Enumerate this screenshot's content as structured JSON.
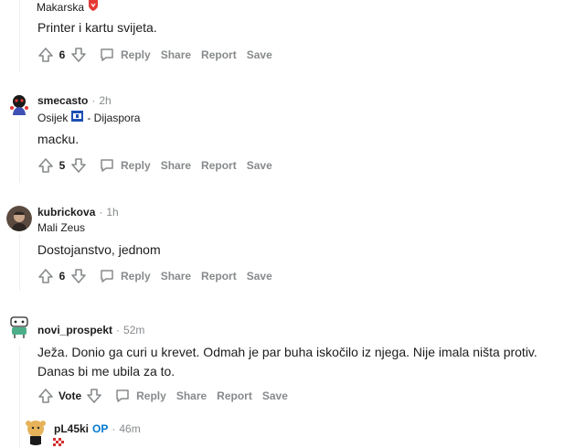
{
  "actions": {
    "reply": "Reply",
    "share": "Share",
    "report": "Report",
    "save": "Save"
  },
  "comments": [
    {
      "flair": "Makarska",
      "body": "Printer i kartu svijeta.",
      "score": "6"
    },
    {
      "author": "smecasto",
      "time": "2h",
      "flair": "Osijek",
      "flair_extra": "- Dijaspora",
      "body": "macku.",
      "score": "5"
    },
    {
      "author": "kubrickova",
      "time": "1h",
      "flair": "Mali Zeus",
      "body": "Dostojanstvo, jednom",
      "score": "6"
    },
    {
      "author": "novi_prospekt",
      "time": "52m",
      "body": "Ježa. Donio ga curi u krevet. Odmah je par buha iskočilo iz njega. Nije imala ništa protiv. Danas bi me ubila za to.",
      "score": "Vote"
    },
    {
      "author": "pL45ki",
      "badge": "OP",
      "time": "46m"
    }
  ],
  "colors": {
    "meta": "#878a8c",
    "op": "#0079d3",
    "text": "#1c1c1c"
  }
}
